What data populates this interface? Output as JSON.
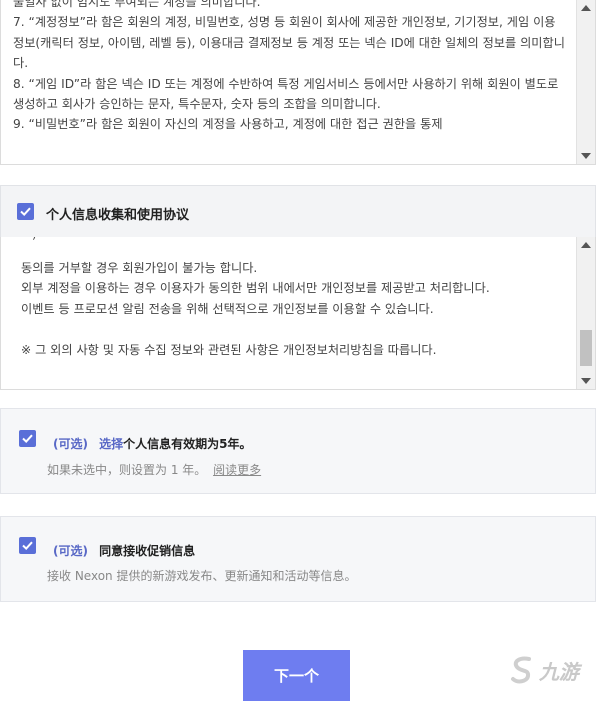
{
  "terms": {
    "text": "불일사 없이 임시도 부여되는 계정을 의미합니다.\n7. “계정정보”라 함은 회원의 계정, 비밀번호, 성명 등 회원이 회사에 제공한 개인정보, 기기정보, 게임 이용정보(캐릭터 정보, 아이템, 레벨 등), 이용대금 결제정보 등 계정 또는 넥슨 ID에 대한 일체의 정보를 의미합니다.\n8. “게임 ID”라 함은 넥슨 ID 또는 계정에 수반하여 특정 게임서비스 등에서만 사용하기 위해 회원이 별도로 생성하고 회사가 승인하는 문자, 특수문자, 숫자 등의 조합을 의미합니다.\n9. “비밀번호”라 함은 회원이 자신의 계정을 사용하고, 계정에 대한 접근 권한을 통제"
  },
  "privacy": {
    "title": "个人信息收集和使用协议",
    "text": "동의를 거부할 경우 회원가입이 불가능 합니다.\n외부 계정을 이용하는 경우 이용자가 동의한 범위 내에서만 개인정보를 제공받고 처리합니다.\n이벤트 등 프로모션 알림 전송을 위해 선택적으로 개인정보를 이용할 수 있습니다.\n\n※ 그 외의 사항 및 자동 수집 정보와 관련된 사항은 개인정보처리방침을 따릅니다."
  },
  "option1": {
    "tag": "(可选)",
    "link": "选择",
    "title": "个人信息有效期为5年。",
    "desc": "如果未选中，则设置为 1 年。",
    "read_more": "阅读更多"
  },
  "option2": {
    "tag": "(可选)",
    "title": "同意接收促销信息",
    "desc": "接收 Nexon 提供的新游戏发布、更新通知和活动等信息。"
  },
  "next_button": "下一个",
  "watermark": "九游",
  "colors": {
    "accent": "#5a6fd8",
    "button": "#6e7df0",
    "link": "#5868c6"
  }
}
